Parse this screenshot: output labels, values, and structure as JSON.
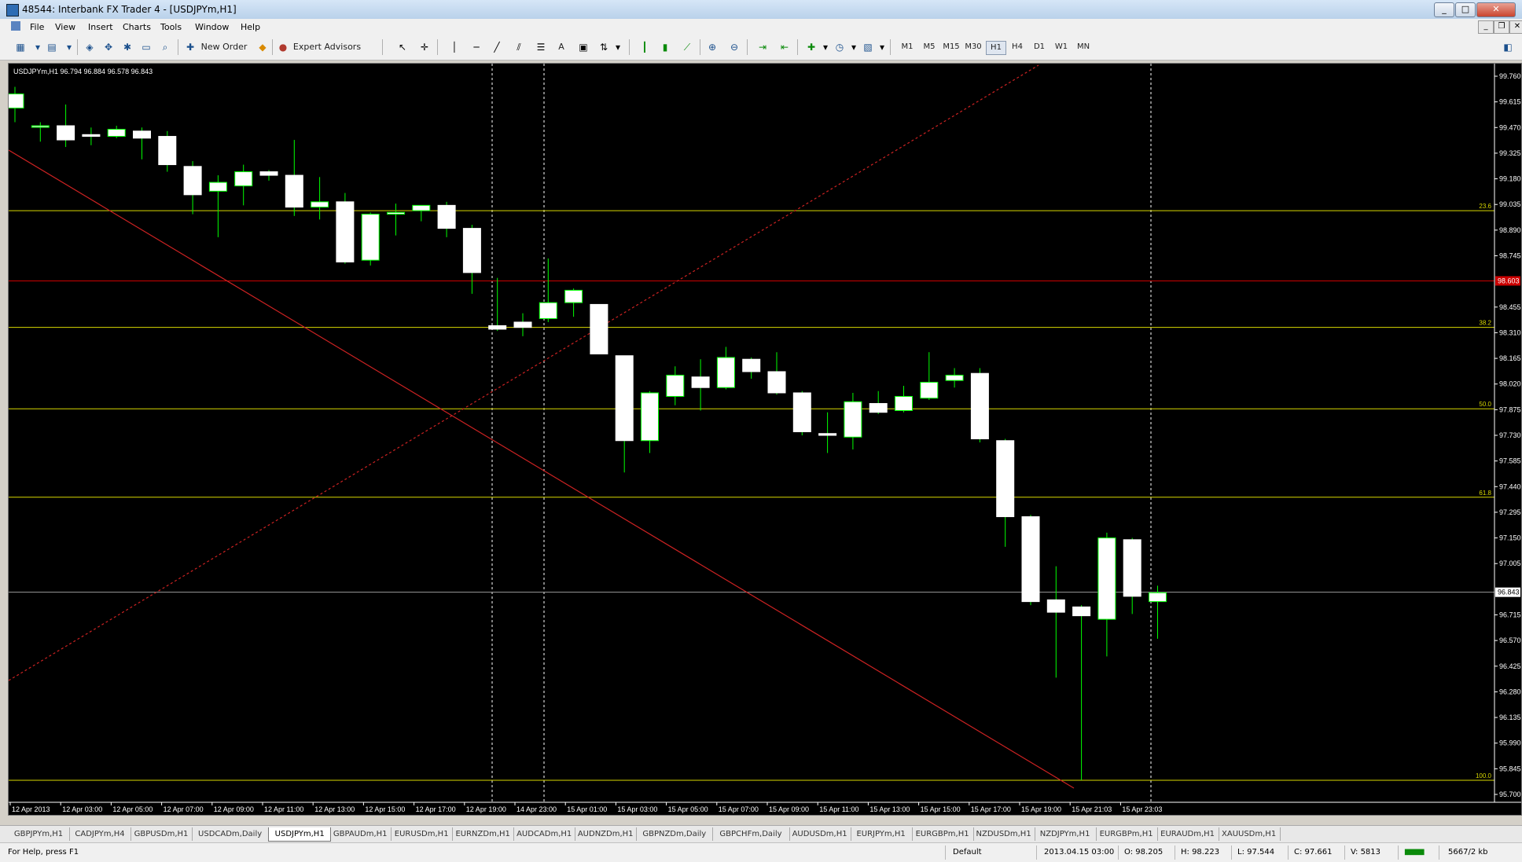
{
  "window": {
    "title": "48544: Interbank FX Trader 4 - [USDJPYm,H1]"
  },
  "menu": [
    "File",
    "View",
    "Insert",
    "Charts",
    "Tools",
    "Window",
    "Help"
  ],
  "toolbar": {
    "new_order": "New Order",
    "expert_advisors": "Expert Advisors",
    "timeframes": [
      "M1",
      "M5",
      "M15",
      "M30",
      "H1",
      "H4",
      "D1",
      "W1",
      "MN"
    ],
    "active_timeframe": "H1",
    "drawing_text_tool": "A"
  },
  "chart": {
    "info": "USDJPYm,H1  96.794 96.884 96.578 96.843",
    "bg": "#000000",
    "bull_color": "#00ff00",
    "bear_color": "#ffffff",
    "candle_body_color": "#ffffff",
    "price_labels": [
      "99.760",
      "99.615",
      "99.470",
      "99.325",
      "99.180",
      "99.035",
      "98.890",
      "98.745",
      "98.603",
      "98.455",
      "98.310",
      "98.165",
      "98.020",
      "97.875",
      "97.730",
      "97.585",
      "97.440",
      "97.295",
      "97.150",
      "97.005",
      "96.843",
      "96.715",
      "96.570",
      "96.425",
      "96.280",
      "96.135",
      "95.990",
      "95.845",
      "95.700"
    ],
    "current_price": "96.843",
    "hline_price": "98.603",
    "fib_levels": [
      {
        "label": "23.6",
        "price": 99.0
      },
      {
        "label": "38.2",
        "price": 98.34
      },
      {
        "label": "50.0",
        "price": 97.88
      },
      {
        "label": "61.8",
        "price": 97.38
      },
      {
        "label": "100.0",
        "price": 95.78
      }
    ],
    "time_labels": [
      "12 Apr 2013",
      "12 Apr 03:00",
      "12 Apr 05:00",
      "12 Apr 07:00",
      "12 Apr 09:00",
      "12 Apr 11:00",
      "12 Apr 13:00",
      "12 Apr 15:00",
      "12 Apr 17:00",
      "12 Apr 19:00",
      "14 Apr 23:00",
      "15 Apr 01:00",
      "15 Apr 03:00",
      "15 Apr 05:00",
      "15 Apr 07:00",
      "15 Apr 09:00",
      "15 Apr 11:00",
      "15 Apr 13:00",
      "15 Apr 15:00",
      "15 Apr 17:00",
      "15 Apr 19:00",
      "15 Apr 21:03",
      "15 Apr 23:03"
    ],
    "candles": [
      {
        "o": 99.58,
        "h": 99.7,
        "l": 99.5,
        "c": 99.66
      },
      {
        "o": 99.48,
        "h": 99.5,
        "l": 99.39,
        "c": 99.48
      },
      {
        "o": 99.48,
        "h": 99.6,
        "l": 99.36,
        "c": 99.4
      },
      {
        "o": 99.43,
        "h": 99.47,
        "l": 99.37,
        "c": 99.42
      },
      {
        "o": 99.42,
        "h": 99.48,
        "l": 99.41,
        "c": 99.46
      },
      {
        "o": 99.45,
        "h": 99.47,
        "l": 99.29,
        "c": 99.41
      },
      {
        "o": 99.42,
        "h": 99.45,
        "l": 99.22,
        "c": 99.26
      },
      {
        "o": 99.25,
        "h": 99.28,
        "l": 98.98,
        "c": 99.09
      },
      {
        "o": 99.11,
        "h": 99.2,
        "l": 98.85,
        "c": 99.16
      },
      {
        "o": 99.14,
        "h": 99.26,
        "l": 99.03,
        "c": 99.22
      },
      {
        "o": 99.22,
        "h": 99.23,
        "l": 99.17,
        "c": 99.2
      },
      {
        "o": 99.2,
        "h": 99.4,
        "l": 98.97,
        "c": 99.02
      },
      {
        "o": 99.02,
        "h": 99.19,
        "l": 98.95,
        "c": 99.05
      },
      {
        "o": 99.05,
        "h": 99.1,
        "l": 98.7,
        "c": 98.71
      },
      {
        "o": 98.72,
        "h": 98.99,
        "l": 98.69,
        "c": 98.98
      },
      {
        "o": 98.98,
        "h": 99.04,
        "l": 98.86,
        "c": 98.99
      },
      {
        "o": 99.0,
        "h": 99.03,
        "l": 98.94,
        "c": 99.03
      },
      {
        "o": 99.03,
        "h": 99.05,
        "l": 98.85,
        "c": 98.9
      },
      {
        "o": 98.9,
        "h": 98.92,
        "l": 98.53,
        "c": 98.65
      },
      {
        "o": 98.35,
        "h": 98.62,
        "l": 98.32,
        "c": 98.33
      },
      {
        "o": 98.37,
        "h": 98.42,
        "l": 98.29,
        "c": 98.34
      },
      {
        "o": 98.39,
        "h": 98.73,
        "l": 98.37,
        "c": 98.48
      },
      {
        "o": 98.48,
        "h": 98.56,
        "l": 98.4,
        "c": 98.55
      },
      {
        "o": 98.47,
        "h": 98.47,
        "l": 98.19,
        "c": 98.19
      },
      {
        "o": 98.18,
        "h": 98.18,
        "l": 97.52,
        "c": 97.7
      },
      {
        "o": 97.7,
        "h": 97.98,
        "l": 97.63,
        "c": 97.97
      },
      {
        "o": 97.95,
        "h": 98.12,
        "l": 97.9,
        "c": 98.07
      },
      {
        "o": 98.06,
        "h": 98.16,
        "l": 97.87,
        "c": 98.0
      },
      {
        "o": 98.0,
        "h": 98.23,
        "l": 97.99,
        "c": 98.17
      },
      {
        "o": 98.16,
        "h": 98.17,
        "l": 98.05,
        "c": 98.09
      },
      {
        "o": 98.09,
        "h": 98.2,
        "l": 97.96,
        "c": 97.97
      },
      {
        "o": 97.97,
        "h": 97.98,
        "l": 97.73,
        "c": 97.75
      },
      {
        "o": 97.74,
        "h": 97.86,
        "l": 97.63,
        "c": 97.73
      },
      {
        "o": 97.72,
        "h": 97.97,
        "l": 97.65,
        "c": 97.92
      },
      {
        "o": 97.91,
        "h": 97.98,
        "l": 97.85,
        "c": 97.86
      },
      {
        "o": 97.87,
        "h": 98.01,
        "l": 97.86,
        "c": 97.95
      },
      {
        "o": 97.94,
        "h": 98.2,
        "l": 97.93,
        "c": 98.03
      },
      {
        "o": 98.04,
        "h": 98.11,
        "l": 98.0,
        "c": 98.07
      },
      {
        "o": 98.08,
        "h": 98.11,
        "l": 97.69,
        "c": 97.71
      },
      {
        "o": 97.7,
        "h": 97.71,
        "l": 97.1,
        "c": 97.27
      },
      {
        "o": 97.27,
        "h": 97.28,
        "l": 96.77,
        "c": 96.79
      },
      {
        "o": 96.8,
        "h": 96.99,
        "l": 96.36,
        "c": 96.73
      },
      {
        "o": 96.76,
        "h": 96.77,
        "l": 95.78,
        "c": 96.71
      },
      {
        "o": 96.69,
        "h": 97.18,
        "l": 96.48,
        "c": 97.15
      },
      {
        "o": 97.14,
        "h": 97.15,
        "l": 96.72,
        "c": 96.82
      },
      {
        "o": 96.79,
        "h": 96.88,
        "l": 96.58,
        "c": 96.84
      }
    ]
  },
  "symbol_tabs": [
    "GBPJPYm,H1",
    "CADJPYm,H4",
    "GBPUSDm,H1",
    "USDCADm,Daily",
    "USDJPYm,H1",
    "GBPAUDm,H1",
    "EURUSDm,H1",
    "EURNZDm,H1",
    "AUDCADm,H1",
    "AUDNZDm,H1",
    "GBPNZDm,Daily",
    "GBPCHFm,Daily",
    "AUDUSDm,H1",
    "EURJPYm,H1",
    "EURGBPm,H1",
    "NZDUSDm,H1",
    "NZDJPYm,H1",
    "EURGBPm,H1",
    "EURAUDm,H1",
    "XAUUSDm,H1"
  ],
  "active_tab": "USDJPYm,H1",
  "status": {
    "help": "For Help, press F1",
    "profile": "Default",
    "datetime": "2013.04.15 03:00",
    "open": "O: 98.205",
    "high": "H: 98.223",
    "low": "L: 97.544",
    "close": "C: 97.661",
    "volume": "V: 5813",
    "traffic": "5667/2 kb"
  }
}
